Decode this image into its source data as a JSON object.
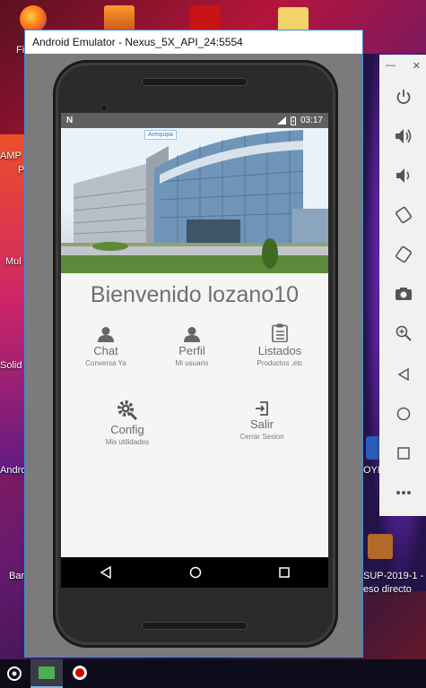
{
  "emulator": {
    "window_title": "Android Emulator - Nexus_5X_API_24:5554"
  },
  "status_bar": {
    "time": "03:17",
    "left_icon": "n-notification-icon"
  },
  "hero": {
    "tag": "Arequipa"
  },
  "app": {
    "welcome": "Bienvenido lozano10",
    "tiles": [
      {
        "title": "Chat",
        "subtitle": "Conversa Ya",
        "icon": "person-icon"
      },
      {
        "title": "Perfil",
        "subtitle": "Mi usuario",
        "icon": "person-icon"
      },
      {
        "title": "Listados",
        "subtitle": "Productos ,etc",
        "icon": "clipboard-icon"
      },
      {
        "title": "Config",
        "subtitle": "Mis utilidades",
        "icon": "gear-search-icon"
      },
      {
        "title": "Salir",
        "subtitle": "Cerrar Sesion",
        "icon": "logout-icon"
      }
    ]
  },
  "desktop": {
    "labels": [
      "Fi",
      "AMP",
      "P",
      "Mul",
      "Solid",
      "Andro",
      "Ban",
      "OYE",
      "SUP-2019-1 -",
      "eso directo"
    ]
  },
  "colors": {
    "window_border": "#3a8bd8",
    "text_gray": "#6f6f6f",
    "status_bar": "#606060"
  }
}
